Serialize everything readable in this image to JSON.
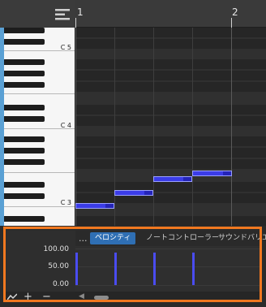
{
  "ruler": {
    "bar1": "1",
    "bar2": "2"
  },
  "keyboard": {
    "c5": "C 5",
    "c4": "C 4",
    "c3": "C 3"
  },
  "tabs": {
    "more": "...",
    "velocity": "ベロシティ",
    "note_controller": "ノートコントローラー",
    "sound_variation": "サウンドバリエ"
  },
  "velocity_axis": {
    "top": "100.00",
    "mid": "50.00",
    "bottom": "0.00"
  },
  "notes": [
    {
      "pitch": "C 3",
      "velocity": 100
    },
    {
      "pitch": "E 3",
      "velocity": 100
    },
    {
      "pitch": "G 3",
      "velocity": 100
    },
    {
      "pitch": "B 3",
      "velocity": 100
    }
  ],
  "bottom_toolbar": {
    "curve_icon": "curve-icon",
    "add_icon": "plus-icon",
    "remove_icon": "minus-icon"
  },
  "colors": {
    "accent": "#2f6fb4",
    "note": "#3b3ce8",
    "highlight": "#f07820"
  }
}
